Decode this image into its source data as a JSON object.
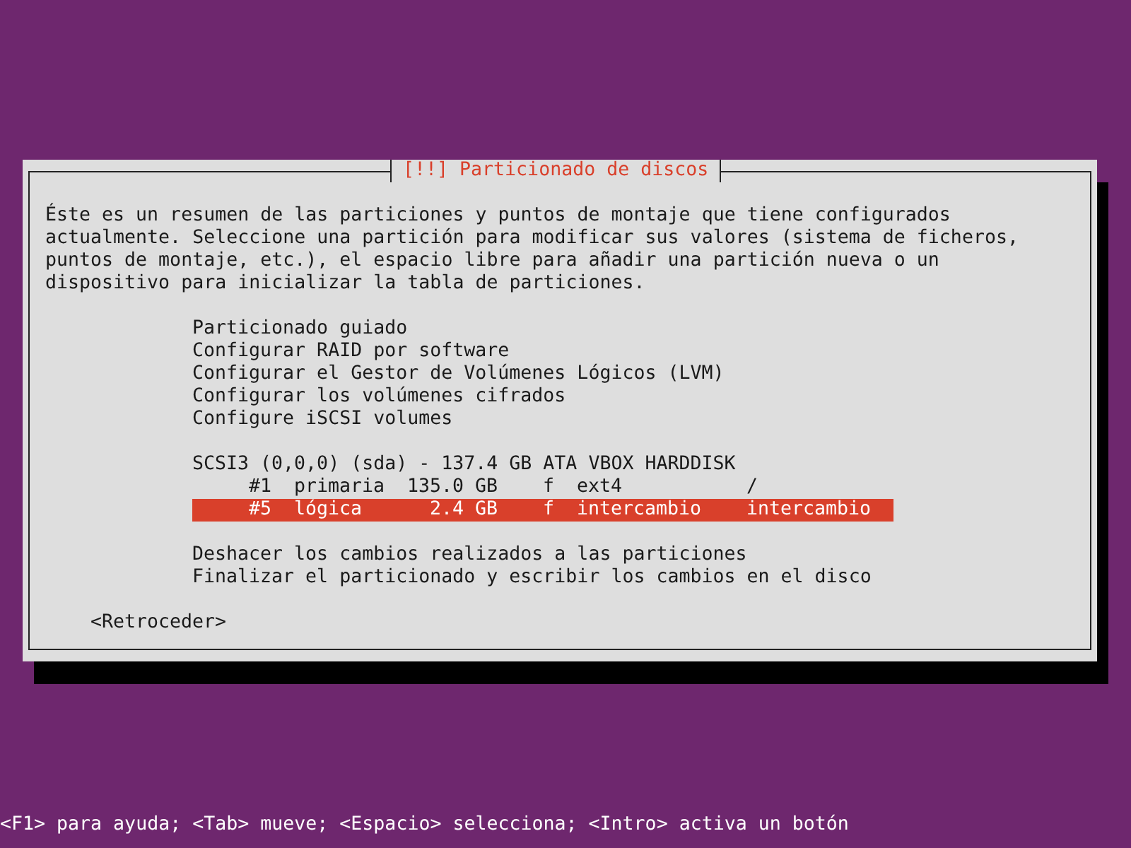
{
  "dialog": {
    "title": "[!!] Particionado de discos",
    "description": "Éste es un resumen de las particiones y puntos de montaje que tiene configurados actualmente. Seleccione una partición para modificar sus valores (sistema de ficheros, puntos de montaje, etc.), el espacio libre para añadir una partición nueva o un dispositivo para inicializar la tabla de particiones.",
    "tools": [
      {
        "label": "Particionado guiado",
        "selected": false
      },
      {
        "label": "Configurar RAID por software",
        "selected": false
      },
      {
        "label": "Configurar el Gestor de Volúmenes Lógicos (LVM)",
        "selected": false
      },
      {
        "label": "Configurar los volúmenes cifrados",
        "selected": false
      },
      {
        "label": "Configure iSCSI volumes",
        "selected": false
      }
    ],
    "disk": {
      "label": "SCSI3 (0,0,0) (sda) - 137.4 GB ATA VBOX HARDDISK",
      "selected": false
    },
    "partitions": [
      {
        "number": "#1",
        "type": "primaria",
        "size": "135.0 GB",
        "flag": "f",
        "filesystem": "ext4",
        "mount": "/",
        "selected": false
      },
      {
        "number": "#5",
        "type": "lógica",
        "size": "2.4 GB",
        "flag": "f",
        "filesystem": "intercambio",
        "mount": "intercambio",
        "selected": true
      }
    ],
    "actions": [
      {
        "label": "Deshacer los cambios realizados a las particiones",
        "selected": false
      },
      {
        "label": "Finalizar el particionado y escribir los cambios en el disco",
        "selected": false
      }
    ],
    "back_button": "<Retroceder>"
  },
  "status_bar": "<F1> para ayuda; <Tab> mueve; <Espacio> selecciona; <Intro> activa un botón"
}
